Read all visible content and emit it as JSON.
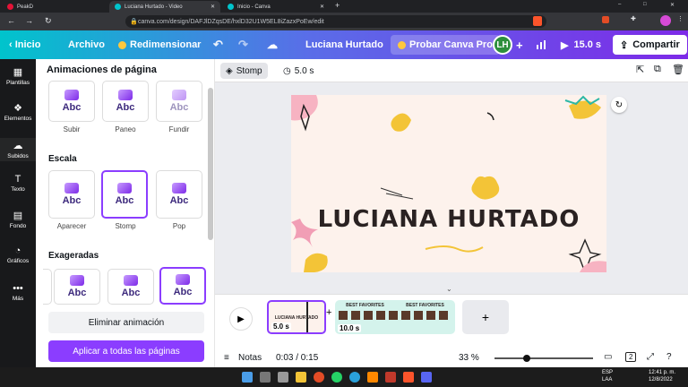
{
  "browser": {
    "tabs": [
      {
        "title": "PeakD"
      },
      {
        "title": "Luciana Hurtado - Video"
      },
      {
        "title": "Inicio - Canva"
      }
    ],
    "new_tab_label": "+",
    "url": "canva.com/design/DAFJlDZqsDE/hxlD32U1W5EL8iZazxPoEw/edit",
    "window_controls": [
      "–",
      "□",
      "✕"
    ]
  },
  "editor_bar": {
    "back_label": "‹ Inicio",
    "file_label": "Archivo",
    "resize_label": "Redimensionar",
    "design_title": "Luciana Hurtado",
    "try_pro_label": "Probar Canva Pro",
    "avatar_initials": "LH",
    "add_label": "+",
    "play_duration": "15.0 s",
    "share_label": "Compartir"
  },
  "rail": {
    "items": [
      {
        "icon": "templates-icon",
        "glyph": "▦",
        "label": "Plantillas"
      },
      {
        "icon": "elements-icon",
        "glyph": "❖",
        "label": "Elementos"
      },
      {
        "icon": "upload-icon",
        "glyph": "☁",
        "label": "Subidos"
      },
      {
        "icon": "text-icon",
        "glyph": "T",
        "label": "Texto"
      },
      {
        "icon": "background-icon",
        "glyph": "▤",
        "label": "Fondo"
      },
      {
        "icon": "charts-icon",
        "glyph": "◔",
        "label": "Gráficos"
      },
      {
        "icon": "more-icon",
        "glyph": "•••",
        "label": "Más"
      }
    ]
  },
  "panel": {
    "title": "Animaciones de página",
    "top_row": [
      "Subir",
      "Paneo",
      "Fundir"
    ],
    "scale_title": "Escala",
    "scale_row": [
      "Aparecer",
      "Stomp",
      "Pop"
    ],
    "exaggerated_title": "Exageradas",
    "card_text": "Abc",
    "remove_label": "Eliminar animación",
    "apply_all_label": "Aplicar a todas las páginas"
  },
  "context_bar": {
    "animation_label": "Stomp",
    "duration_label": "5.0 s"
  },
  "slide": {
    "title": "LUCIANA HURTADO"
  },
  "timeline": {
    "clip1_duration": "5.0 s",
    "clip1_label": "LUCIANA HURTADO",
    "clip2_duration": "10.0 s",
    "clip2_header": "BEST FAVORITES",
    "add_page_label": "+"
  },
  "status_bar": {
    "notes_label": "Notas",
    "time": "0:03 / 0:15",
    "zoom": "33 %",
    "zoom_fraction": 0.33,
    "page_count": "2"
  },
  "taskbar": {
    "lang": "ESP",
    "layout": "LAA",
    "time": "12:41 p. m.",
    "date": "12/8/2022"
  },
  "colors": {
    "brand_gradient_start": "#00c4cc",
    "brand_gradient_end": "#7d2ae8",
    "accent_purple": "#8b3dff",
    "rail_bg": "#18191b"
  }
}
